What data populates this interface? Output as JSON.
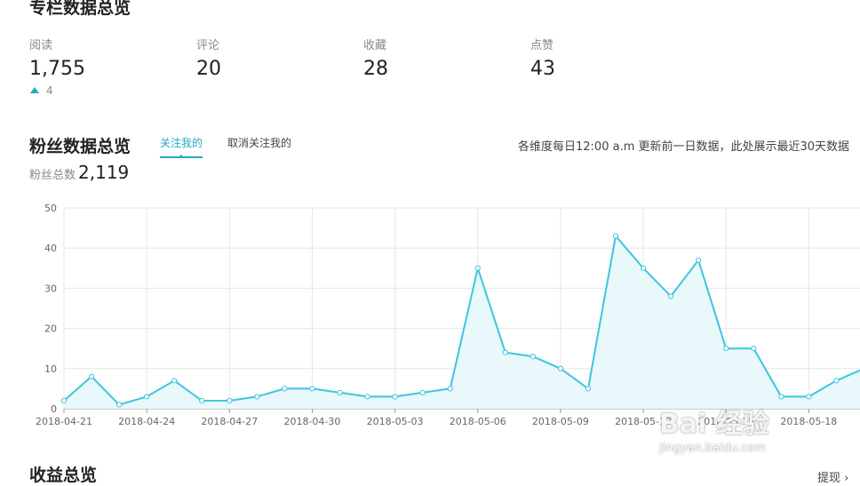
{
  "overview": {
    "title": "专栏数据总览",
    "stats": [
      {
        "label": "阅读",
        "value": "1,755"
      },
      {
        "label": "评论",
        "value": "20"
      },
      {
        "label": "收藏",
        "value": "28"
      },
      {
        "label": "点赞",
        "value": "43"
      }
    ],
    "read_delta": "4"
  },
  "fans": {
    "title": "粉丝数据总览",
    "tabs": [
      "关注我的",
      "取消关注我的"
    ],
    "active_tab": 0,
    "note": "各维度每日12:00 a.m 更新前一日数据，此处展示最近30天数据",
    "total_label": "粉丝总数",
    "total_value": "2,119"
  },
  "income": {
    "title": "收益总览",
    "link": "提现"
  },
  "watermark": {
    "main": "Bai 经验",
    "sub": "jingyan.baidu.com"
  },
  "colors": {
    "accent": "#2aa6c6",
    "line": "#3ec5dd",
    "area": "#e8f8fb"
  },
  "chart_data": {
    "type": "area",
    "x": [
      "2018-04-21",
      "2018-04-22",
      "2018-04-23",
      "2018-04-24",
      "2018-04-25",
      "2018-04-26",
      "2018-04-27",
      "2018-04-28",
      "2018-04-29",
      "2018-04-30",
      "2018-05-01",
      "2018-05-02",
      "2018-05-03",
      "2018-05-04",
      "2018-05-05",
      "2018-05-06",
      "2018-05-07",
      "2018-05-08",
      "2018-05-09",
      "2018-05-10",
      "2018-05-11",
      "2018-05-12",
      "2018-05-13",
      "2018-05-14",
      "2018-05-15",
      "2018-05-16",
      "2018-05-17",
      "2018-05-18",
      "2018-05-19",
      "2018-05-20"
    ],
    "series": [
      {
        "values": [
          2,
          8,
          1,
          3,
          7,
          2,
          2,
          3,
          5,
          5,
          4,
          3,
          3,
          4,
          5,
          35,
          14,
          13,
          10,
          5,
          43,
          35,
          28,
          37,
          15,
          15,
          3,
          3,
          7,
          10
        ]
      }
    ],
    "x_tick_labels": [
      "2018-04-21",
      "2018-04-24",
      "2018-04-27",
      "2018-04-30",
      "2018-05-03",
      "2018-05-06",
      "2018-05-09",
      "2018-05-12",
      "2018-05-15",
      "2018-05-18"
    ],
    "y_ticks": [
      0,
      10,
      20,
      30,
      40,
      50
    ],
    "ylim": [
      0,
      50
    ],
    "grid": true
  }
}
